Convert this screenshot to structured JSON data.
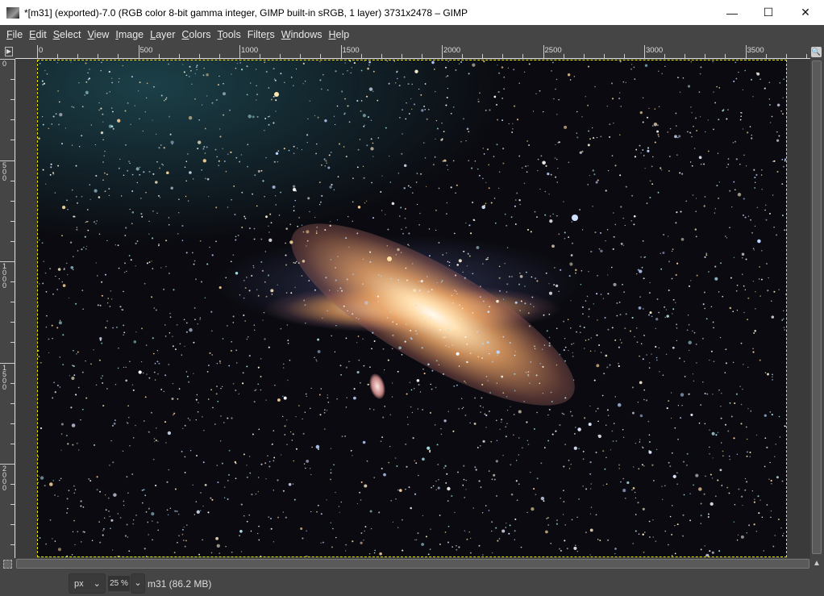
{
  "window": {
    "title": "*[m31] (exported)-7.0 (RGB color 8-bit gamma integer, GIMP built-in sRGB, 1 layer) 3731x2478 – GIMP",
    "minimize": "—",
    "maximize": "☐",
    "close": "✕"
  },
  "menu": [
    {
      "key": "F",
      "rest": "ile"
    },
    {
      "key": "E",
      "rest": "dit"
    },
    {
      "key": "S",
      "rest": "elect"
    },
    {
      "key": "V",
      "rest": "iew"
    },
    {
      "key": "I",
      "rest": "mage"
    },
    {
      "key": "L",
      "rest": "ayer"
    },
    {
      "key": "C",
      "rest": "olors"
    },
    {
      "key": "T",
      "rest": "ools"
    },
    {
      "pre": "Filte",
      "key": "r",
      "rest": "s"
    },
    {
      "key": "W",
      "rest": "indows"
    },
    {
      "key": "H",
      "rest": "elp"
    }
  ],
  "rulers": {
    "horizontal": [
      "0",
      "500",
      "1000",
      "1500",
      "2000",
      "2500",
      "3000",
      "3500"
    ],
    "vertical": [
      "0",
      "500",
      "1000",
      "1500",
      "2000"
    ]
  },
  "status": {
    "unit": "px",
    "zoom": "25 %",
    "info": "m31 (86.2 MB)"
  },
  "icons": {
    "unit_dropdown": "chevron-down-icon",
    "zoom_dropdown": "chevron-down-icon"
  }
}
